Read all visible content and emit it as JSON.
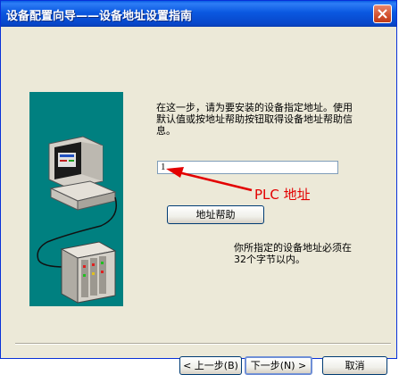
{
  "window": {
    "title": "设备配置向导——设备地址设置指南"
  },
  "instructions": "在这一步，请为要安装的设备指定地址。使用默认值或按地址帮助按钮取得设备地址帮助信息。",
  "address_field": {
    "value": "1"
  },
  "annotation": "PLC 地址",
  "help_button": "地址帮助",
  "note": "你所指定的设备地址必须在32个字节以内。",
  "footer": {
    "back": "< 上一步(B)",
    "next": "下一步(N) >",
    "cancel": "取消"
  },
  "colors": {
    "title_bar": "#0a58e0",
    "art_background": "#008080",
    "annotation": "#e30000"
  }
}
